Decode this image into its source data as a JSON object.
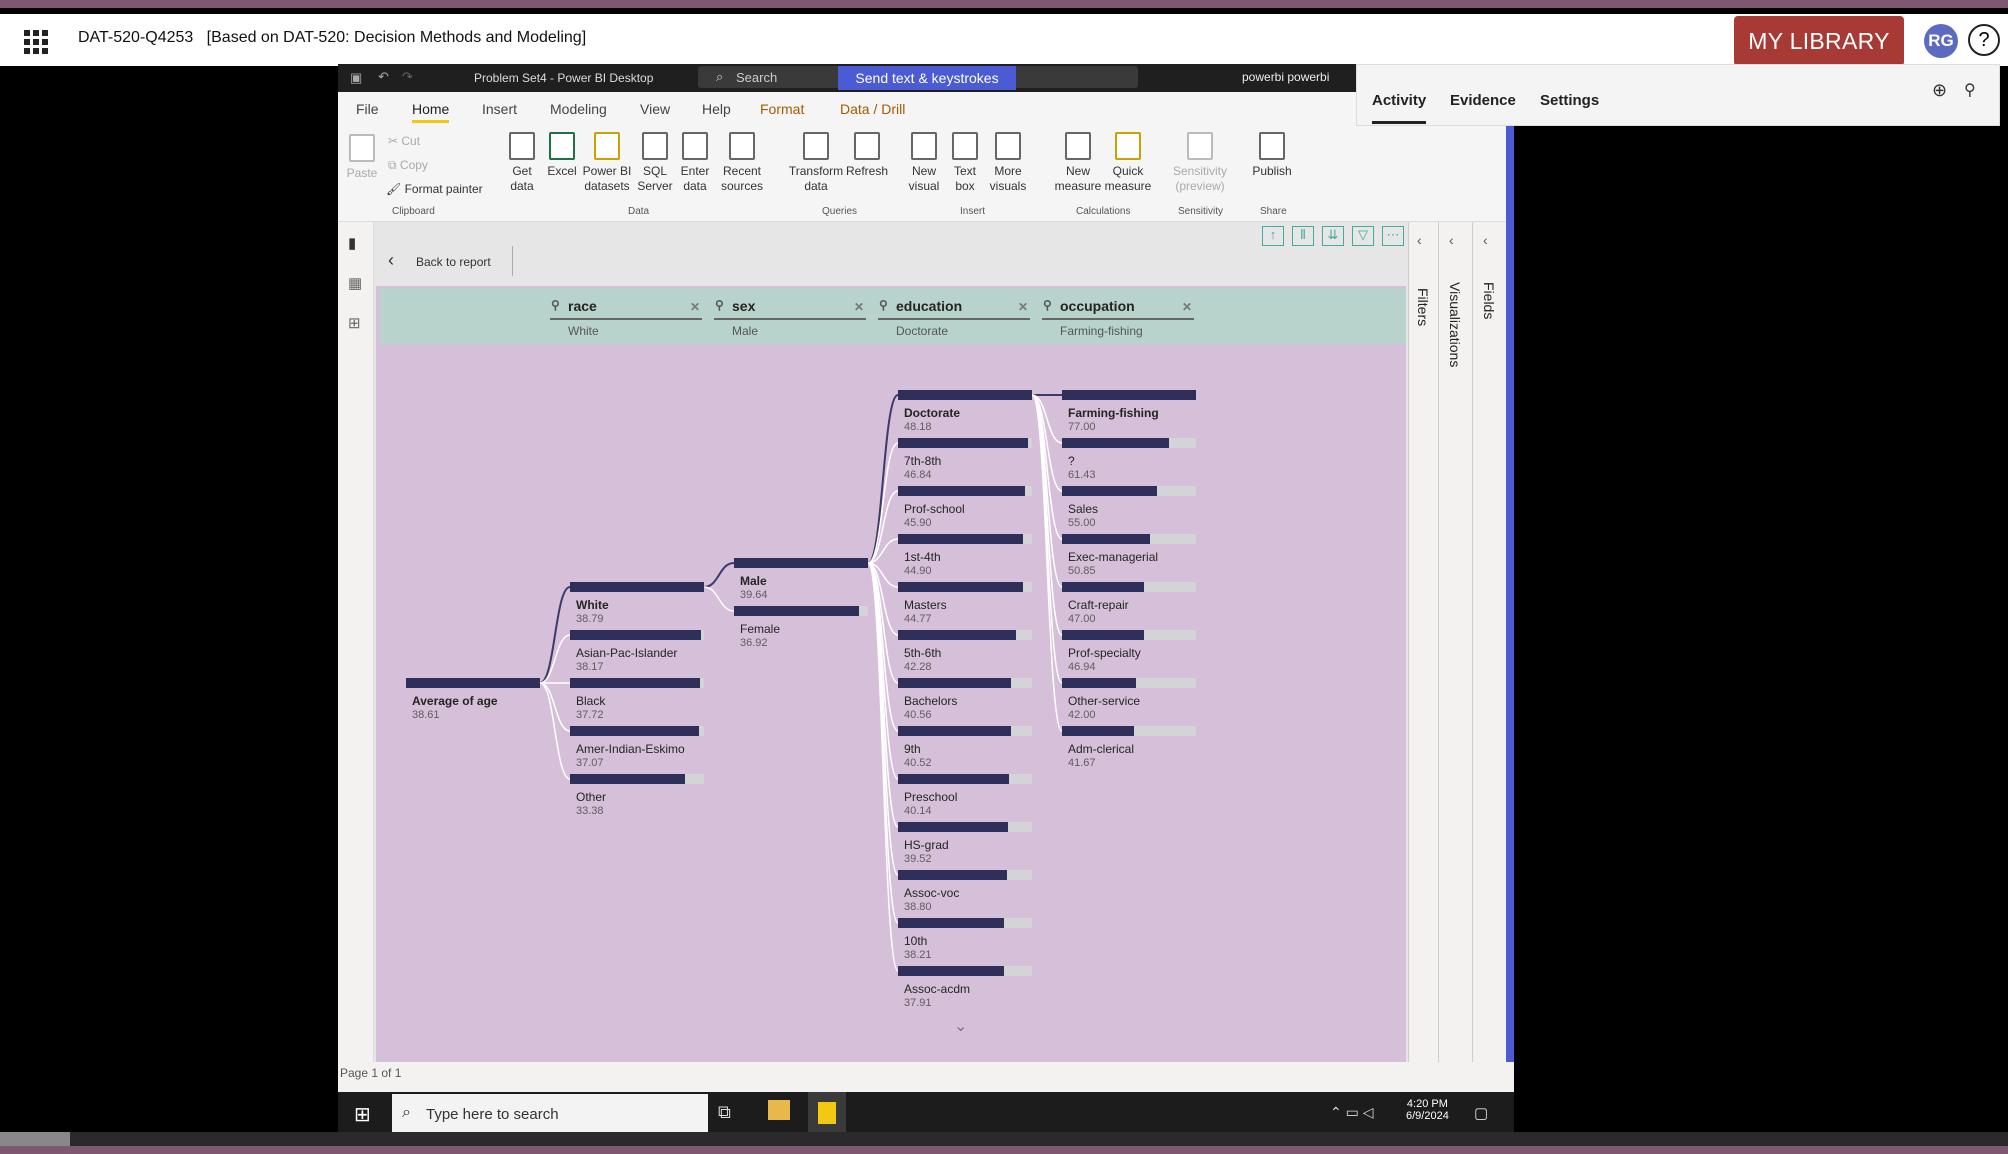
{
  "app": {
    "title": "DAT-520-Q4253",
    "subtitle": "[Based on DAT-520: Decision Methods and Modeling]"
  },
  "header": {
    "my_library": "MY LIBRARY",
    "avatar": "RG",
    "help": "?"
  },
  "side_panel": {
    "tabs": [
      "Activity",
      "Evidence",
      "Settings"
    ],
    "active": "Activity"
  },
  "pbi": {
    "window_title": "Problem Set4 - Power BI Desktop",
    "search": "Search",
    "send_keys": "Send text & keystrokes",
    "user": "powerbi powerbi",
    "tabs": [
      "File",
      "Home",
      "Insert",
      "Modeling",
      "View",
      "Help",
      "Format",
      "Data / Drill"
    ],
    "clipboard": {
      "paste": "Paste",
      "cut": "Cut",
      "copy": "Copy",
      "format_painter": "Format painter",
      "group": "Clipboard"
    },
    "data_group": {
      "get_data": "Get data",
      "excel": "Excel",
      "pbi_datasets": "Power BI datasets",
      "sql": "SQL Server",
      "enter": "Enter data",
      "recent": "Recent sources",
      "group": "Data"
    },
    "queries_group": {
      "transform": "Transform data",
      "refresh": "Refresh",
      "group": "Queries"
    },
    "insert_group": {
      "new_visual": "New visual",
      "text_box": "Text box",
      "more_visuals": "More visuals",
      "group": "Insert"
    },
    "calc_group": {
      "new_measure": "New measure",
      "quick_measure": "Quick measure",
      "group": "Calculations"
    },
    "sens_group": {
      "sensitivity": "Sensitivity (preview)",
      "group": "Sensitivity"
    },
    "share_group": {
      "publish": "Publish",
      "group": "Share"
    },
    "back": "Back to report",
    "panes": {
      "filters": "Filters",
      "visualizations": "Visualizations",
      "fields": "Fields"
    },
    "page": "Page 1 of 1"
  },
  "tree": {
    "headers": [
      {
        "field": "race",
        "value": "White"
      },
      {
        "field": "sex",
        "value": "Male"
      },
      {
        "field": "education",
        "value": "Doctorate"
      },
      {
        "field": "occupation",
        "value": "Farming-fishing"
      }
    ],
    "root": {
      "label": "Average of age",
      "value": "38.61",
      "fill": 1.0
    },
    "race": [
      {
        "label": "White",
        "value": "38.79",
        "fill": 1.0,
        "selected": true
      },
      {
        "label": "Asian-Pac-Islander",
        "value": "38.17",
        "fill": 0.98
      },
      {
        "label": "Black",
        "value": "37.72",
        "fill": 0.97
      },
      {
        "label": "Amer-Indian-Eskimo",
        "value": "37.07",
        "fill": 0.96
      },
      {
        "label": "Other",
        "value": "33.38",
        "fill": 0.86
      }
    ],
    "sex": [
      {
        "label": "Male",
        "value": "39.64",
        "fill": 1.0,
        "selected": true
      },
      {
        "label": "Female",
        "value": "36.92",
        "fill": 0.93
      }
    ],
    "education": [
      {
        "label": "Doctorate",
        "value": "48.18",
        "fill": 1.0,
        "selected": true
      },
      {
        "label": "7th-8th",
        "value": "46.84",
        "fill": 0.97
      },
      {
        "label": "Prof-school",
        "value": "45.90",
        "fill": 0.95
      },
      {
        "label": "1st-4th",
        "value": "44.90",
        "fill": 0.93
      },
      {
        "label": "Masters",
        "value": "44.77",
        "fill": 0.93
      },
      {
        "label": "5th-6th",
        "value": "42.28",
        "fill": 0.88
      },
      {
        "label": "Bachelors",
        "value": "40.56",
        "fill": 0.84
      },
      {
        "label": "9th",
        "value": "40.52",
        "fill": 0.84
      },
      {
        "label": "Preschool",
        "value": "40.14",
        "fill": 0.83
      },
      {
        "label": "HS-grad",
        "value": "39.52",
        "fill": 0.82
      },
      {
        "label": "Assoc-voc",
        "value": "38.80",
        "fill": 0.81
      },
      {
        "label": "10th",
        "value": "38.21",
        "fill": 0.79
      },
      {
        "label": "Assoc-acdm",
        "value": "37.91",
        "fill": 0.79
      }
    ],
    "occupation": [
      {
        "label": "Farming-fishing",
        "value": "77.00",
        "fill": 1.0,
        "selected": true
      },
      {
        "label": "?",
        "value": "61.43",
        "fill": 0.8
      },
      {
        "label": "Sales",
        "value": "55.00",
        "fill": 0.71
      },
      {
        "label": "Exec-managerial",
        "value": "50.85",
        "fill": 0.66
      },
      {
        "label": "Craft-repair",
        "value": "47.00",
        "fill": 0.61
      },
      {
        "label": "Prof-specialty",
        "value": "46.94",
        "fill": 0.61
      },
      {
        "label": "Other-service",
        "value": "42.00",
        "fill": 0.55
      },
      {
        "label": "Adm-clerical",
        "value": "41.67",
        "fill": 0.54
      }
    ]
  },
  "taskbar": {
    "search": "Type here to search",
    "time": "4:20 PM",
    "date": "6/9/2024"
  }
}
